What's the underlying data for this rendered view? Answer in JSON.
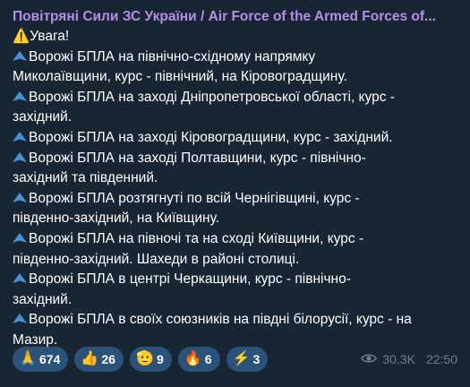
{
  "channel": {
    "name": "Повітряні Сили ЗС України / Air Force of the Armed Forces of..."
  },
  "message": {
    "header": "⚠️Увага!",
    "lines": [
      [
        "Ворожі БПЛА на північно-східному напрямку",
        "Миколаївщини, курс - північний, на Кіровоградщину."
      ],
      [
        "Ворожі БПЛА на заході Дніпропетровської області, курс -",
        "західний."
      ],
      [
        "Ворожі БПЛА на заході Кіровоградщини, курс - західний."
      ],
      [
        "Ворожі БПЛА на заході Полтавщини, курс - північно-",
        "західний та південний."
      ],
      [
        "Ворожі БПЛА розтягнуті по всій Чернігівщині, курс -",
        "південно-західний, на Київщину."
      ],
      [
        "Ворожі БПЛА  на півночі та на сході Київщини, курс -",
        "південно-західний. Шахеди в районі столиці."
      ],
      [
        "Ворожі БПЛА  в центрі Черкащини, курс - північно-",
        "західний."
      ],
      [
        "Ворожі БПЛА в своїх союзників  на півдні білорусії, курс - на",
        "Мазир."
      ]
    ]
  },
  "reactions": [
    {
      "icon": "pray-icon",
      "emoji": "🙏",
      "count": "674"
    },
    {
      "icon": "thumbs-up-icon",
      "emoji": "👍",
      "count": "26"
    },
    {
      "icon": "hand-icon",
      "emoji": "🫡",
      "count": "9"
    },
    {
      "icon": "fire-icon",
      "emoji": "🔥",
      "count": "6"
    },
    {
      "icon": "lightning-icon",
      "emoji": "⚡",
      "count": "3"
    }
  ],
  "meta": {
    "views": "30.3K",
    "time": "22:50"
  },
  "colors": {
    "channel_name": "#b48ee8",
    "bubble": "#182533",
    "reaction_bg": "#2b5278",
    "drone_icon": "#4a90d9"
  }
}
